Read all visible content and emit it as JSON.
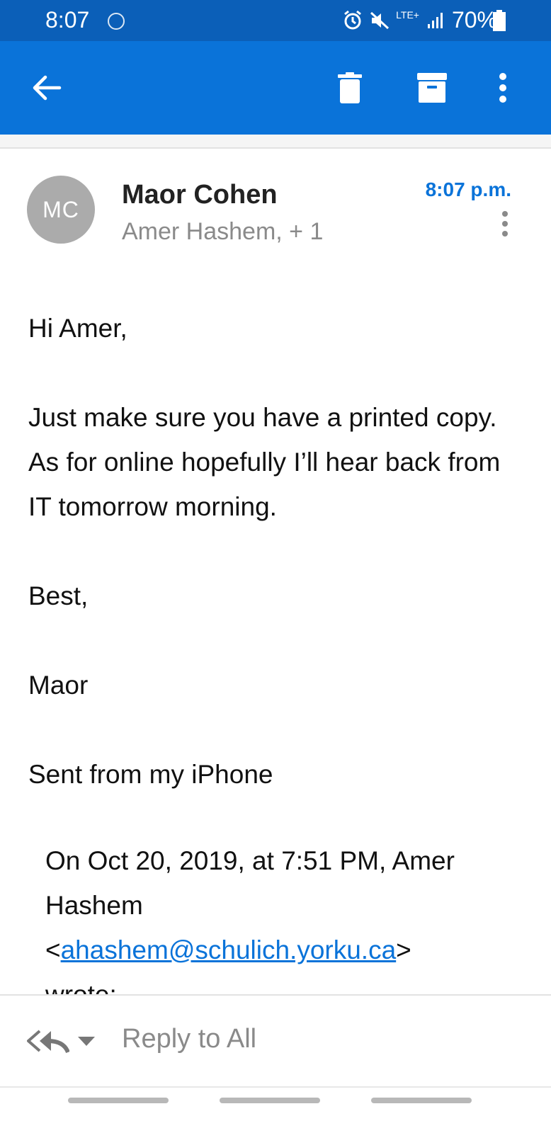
{
  "status_bar": {
    "time": "8:07",
    "network": "LTE+",
    "battery_percent": "70%",
    "icons": [
      "imo-icon",
      "alarm-icon",
      "mute-icon",
      "lte-icon",
      "signal-icon",
      "battery-icon"
    ]
  },
  "app_bar": {
    "color": "#0a73d9",
    "actions": [
      "back-arrow-icon",
      "delete-icon",
      "archive-icon",
      "more-vert-icon"
    ]
  },
  "message": {
    "avatar_initials": "MC",
    "sender": "Maor Cohen",
    "recipients": "Amer Hashem, + 1",
    "time": "8:07 p.m.",
    "greeting": "Hi Amer,",
    "paragraph": "Just make sure you have a printed copy. As for online hopefully I’ll hear back from IT tomorrow morning.",
    "signoff": "Best,",
    "signature": "Maor",
    "sent_from": "Sent from my iPhone",
    "quote": {
      "prefix": "On Oct 20, 2019, at 7:51 PM, Amer Hashem",
      "email_open": "<",
      "email": "ahashem@schulich.yorku.ca",
      "email_close": ">",
      "suffix": "wrote:"
    }
  },
  "reply_bar": {
    "label": "Reply to All"
  }
}
